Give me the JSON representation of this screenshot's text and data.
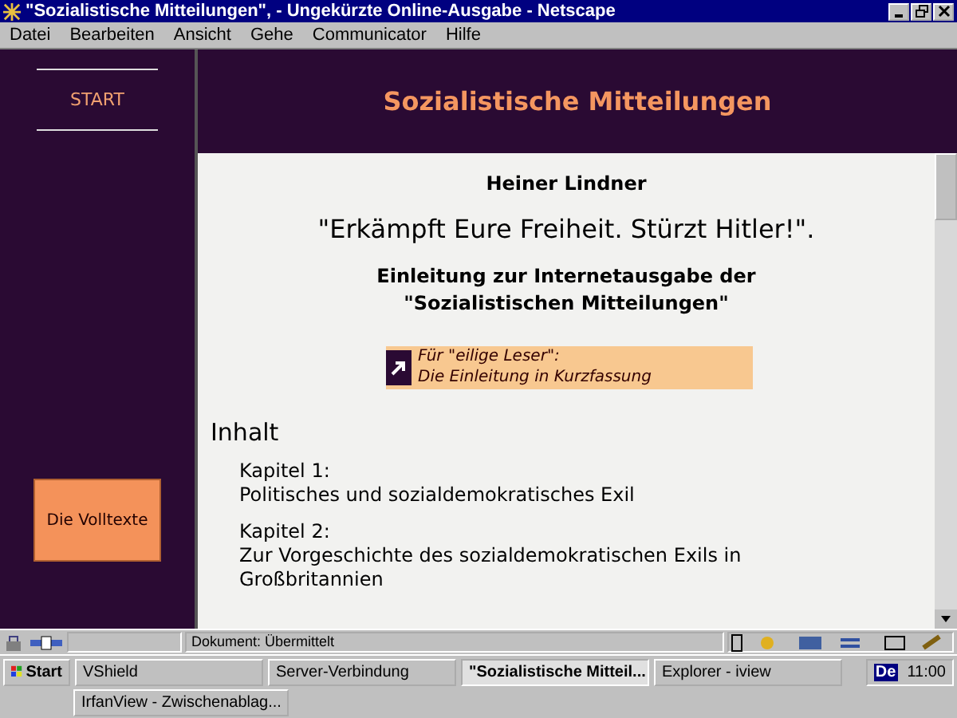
{
  "window": {
    "title": "\"Sozialistische Mitteilungen\", - Ungekürzte Online-Ausgabe - Netscape"
  },
  "menu": [
    "Datei",
    "Bearbeiten",
    "Ansicht",
    "Gehe",
    "Communicator",
    "Hilfe"
  ],
  "sidebar": {
    "items": [
      {
        "label": "START",
        "kind": "link"
      },
      {
        "label": "Die Volltexte",
        "kind": "button"
      }
    ]
  },
  "page": {
    "header_title": "Sozialistische Mitteilungen",
    "author": "Heiner Lindner",
    "quote": "\"Erkämpft Eure Freiheit. Stürzt Hitler!\".",
    "subtitle": "Einleitung zur Internetausgabe der \"Sozialistischen Mitteilungen\"",
    "teaser": [
      "Für \"eilige Leser\":",
      "Die Einleitung in Kurzfassung"
    ],
    "toc_heading": "Inhalt",
    "chapters": [
      {
        "label": "Kapitel 1:",
        "title": "Politisches und sozialdemokratisches Exil"
      },
      {
        "label": "Kapitel 2:",
        "title": "Zur Vorgeschichte des sozialdemokratischen Exils in Großbritannien"
      }
    ]
  },
  "status_bar": {
    "text": "Dokument: Übermittelt"
  },
  "taskbar": {
    "start": "Start",
    "buttons": [
      {
        "label": "VShield",
        "selected": false
      },
      {
        "label": "Server-Verbindung",
        "selected": false
      },
      {
        "label": "\"Sozialistische Mitteil...",
        "selected": true
      },
      {
        "label": "Explorer - iview",
        "selected": false
      },
      {
        "label": "IrfanView - Zwischenablag...",
        "selected": false
      }
    ],
    "language": "De",
    "time": "11:00"
  }
}
